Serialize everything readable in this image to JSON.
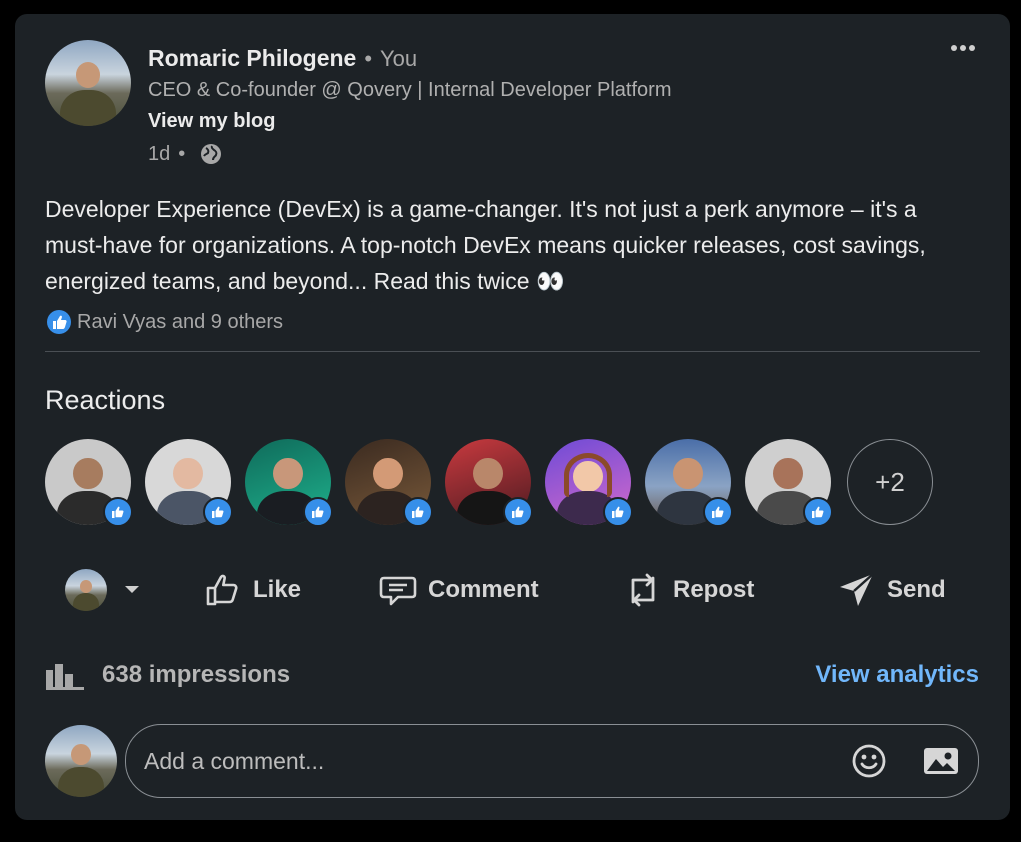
{
  "author": {
    "name": "Romaric Philogene",
    "relation": "You",
    "headline": "CEO & Co-founder @ Qovery | Internal Developer Platform",
    "link_label": "View my blog",
    "time": "1d",
    "visibility_icon": "globe-icon"
  },
  "post": {
    "text": "Developer Experience (DevEx) is a game-changer. It's not just a perk anymore – it's a must-have for organizations. A top-notch DevEx means quicker releases, cost savings, energized teams, and beyond... Read this twice 👀",
    "reactions_summary": "Ravi Vyas and 9 others"
  },
  "reactions": {
    "title": "Reactions",
    "more_label": "+2"
  },
  "actions": {
    "like": "Like",
    "comment": "Comment",
    "repost": "Repost",
    "send": "Send"
  },
  "stats": {
    "impressions": "638 impressions",
    "analytics_label": "View analytics"
  },
  "comment": {
    "placeholder": "Add a comment..."
  },
  "colors": {
    "card_bg": "#1d2226",
    "accent_link": "#71b7fb",
    "like_blue": "#378fe9"
  }
}
